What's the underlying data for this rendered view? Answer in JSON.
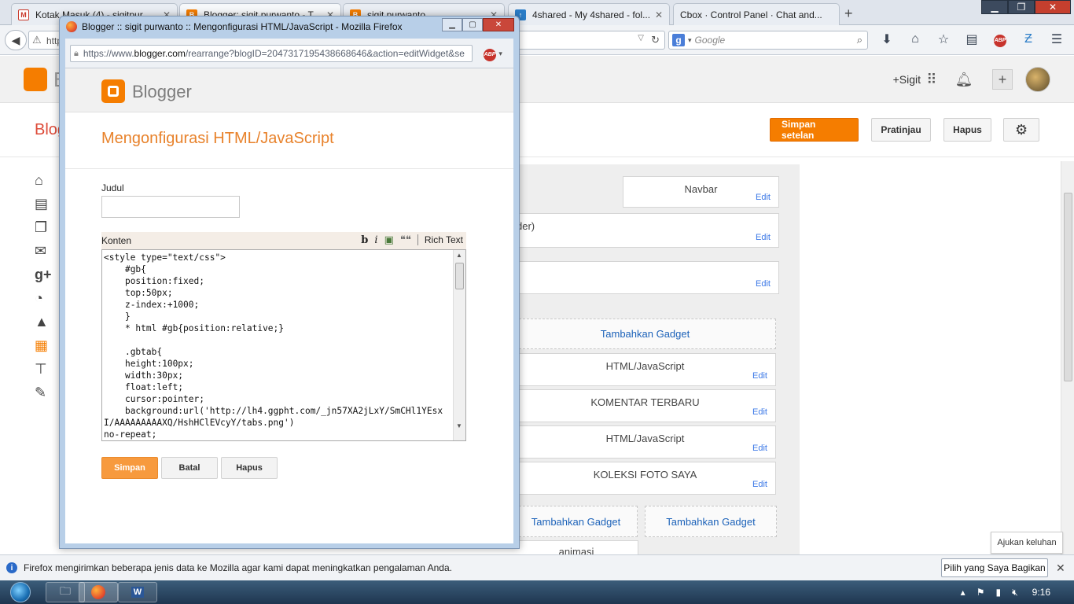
{
  "browser": {
    "tabs": [
      {
        "label": "Kotak Masuk (4) - sigitpur...",
        "color": "#c9392b",
        "fav": "M"
      },
      {
        "label": "Blogger: sigit purwanto - T...",
        "color": "#f57d00",
        "fav": "B"
      },
      {
        "label": "sigit purwanto",
        "color": "#f57d00",
        "fav": "B"
      },
      {
        "label": "4shared - My 4shared - fol...",
        "color": "#2a7cc7",
        "fav": "↑"
      },
      {
        "label": "Cbox · Control Panel · Chat and...",
        "color": "#e9edf3",
        "fav": ""
      }
    ],
    "url_partial": "http",
    "search_placeholder": "Google"
  },
  "blogger_bg": {
    "account": "+Sigit",
    "blog_title_partial": "Blog",
    "buttons": {
      "save": "Simpan setelan",
      "preview": "Pratinjau",
      "delete": "Hapus"
    },
    "gadgets": [
      {
        "title": "Navbar",
        "edit": "Edit"
      },
      {
        "title": "der)",
        "edit": "Edit"
      },
      {
        "title": "",
        "edit": "Edit"
      },
      {
        "title": "HTML/JavaScript",
        "edit": "Edit"
      },
      {
        "title": "KOMENTAR TERBARU",
        "edit": "Edit"
      },
      {
        "title": "HTML/JavaScript",
        "edit": "Edit"
      },
      {
        "title": "KOLEKSI FOTO SAYA",
        "edit": "Edit"
      }
    ],
    "add_gadget": "Tambahkan Gadget",
    "bottom_partial": "animasi",
    "feedback": "Ajukan keluhan"
  },
  "popup": {
    "window_title": "Blogger :: sigit purwanto :: Mengonfigurasi HTML/JavaScript - Mozilla Firefox",
    "url_prefix": "https://www.",
    "url_domain": "blogger.com",
    "url_rest": "/rearrange?blogID=2047317195438668646&action=editWidget&se",
    "brand": "Blogger",
    "heading": "Mengonfigurasi HTML/JavaScript",
    "title_label": "Judul",
    "title_value": "",
    "content_label": "Konten",
    "toolbar": {
      "bold": "b",
      "italic": "i",
      "quote": "❝❝",
      "rich_text": "Rich Text"
    },
    "code": "<style type=\"text/css\">\n    #gb{\n    position:fixed;\n    top:50px;\n    z-index:+1000;\n    }\n    * html #gb{position:relative;}\n\n    .gbtab{\n    height:100px;\n    width:30px;\n    float:left;\n    cursor:pointer;\n    background:url('http://lh4.ggpht.com/_jn57XA2jLxY/SmCHl1YEsxI/AAAAAAAAAXQ/HshHClEVcyY/tabs.png')\nno-repeat;",
    "buttons": {
      "save": "Simpan",
      "cancel": "Batal",
      "delete": "Hapus"
    }
  },
  "notification": {
    "text": "Firefox mengirimkan beberapa jenis data ke Mozilla agar kami dapat meningkatkan pengalaman Anda.",
    "button": "Pilih yang Saya Bagikan"
  },
  "taskbar": {
    "clock": "9:16"
  }
}
